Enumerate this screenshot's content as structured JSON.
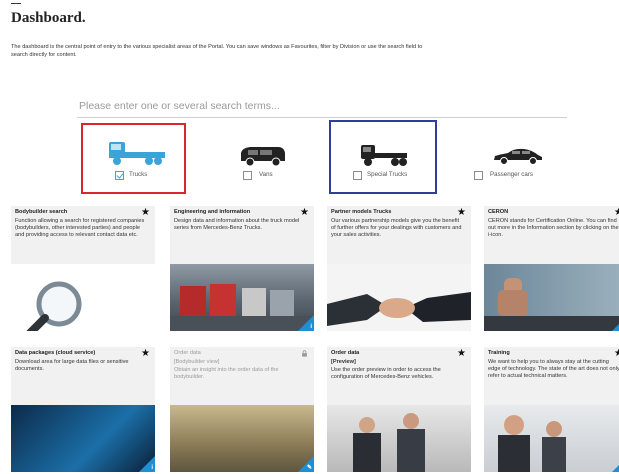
{
  "page": {
    "title": "Dashboard.",
    "intro": "The dashboard is the central point of entry to the various specialist areas of the Portal. You can save windows as Favourites, filter by Division or use the search field to search directly for content."
  },
  "search": {
    "placeholder": "Please enter one or several search terms..."
  },
  "divisions": [
    {
      "label": "Trucks",
      "checked": true,
      "color": "#3aa3d8"
    },
    {
      "label": "Vans",
      "checked": false
    },
    {
      "label": "Special Trucks",
      "checked": false
    },
    {
      "label": "Passenger cars",
      "checked": false
    }
  ],
  "tiles": [
    {
      "title": "Bodybuilder search",
      "desc": "Function allowing a search for registered companies (bodybuilders, other interested parties) and people and providing access to relevant contact data etc.",
      "favourite": true,
      "icon": "star-icon"
    },
    {
      "title": "Engineering and information",
      "desc": "Design data and information about the truck model series from Mercedes-Benz Trucks.",
      "favourite": true,
      "icon": "star-icon"
    },
    {
      "title": "Partner models Trucks",
      "desc": "Our various partnership models give you the benefit of further offers for your dealings with customers and your sales activities.",
      "favourite": true,
      "icon": "star-icon"
    },
    {
      "title": "CERON",
      "desc": "CERON stands for Certification Online. You can find out more in the Information section by clicking on the i-icon.",
      "favourite": true,
      "icon": "star-icon"
    },
    {
      "title": "Data packages (cloud service)",
      "desc": "Download area for large data files or sensitive documents.",
      "favourite": true,
      "icon": "star-icon"
    },
    {
      "title": "Order data",
      "subtitle": "[Bodybuilder view]",
      "desc": "Obtain an insight into the order data of the bodybuilder.",
      "favourite": false,
      "icon": "lock-icon"
    },
    {
      "title": "Order data",
      "subtitle": "[Preview]",
      "desc": "Use the order preview in order to access the configuration of Mercedes-Benz vehicles.",
      "favourite": true,
      "icon": "star-icon"
    },
    {
      "title": "Training",
      "desc": "We want to help you to always stay at the cutting edge of technology. The state of the art does not only refer to actual technical matters.",
      "favourite": true,
      "icon": "star-icon"
    }
  ],
  "colors": {
    "accent_blue": "#1f8fd3",
    "highlight_red": "#d9262c",
    "highlight_blue": "#2f3f95"
  }
}
